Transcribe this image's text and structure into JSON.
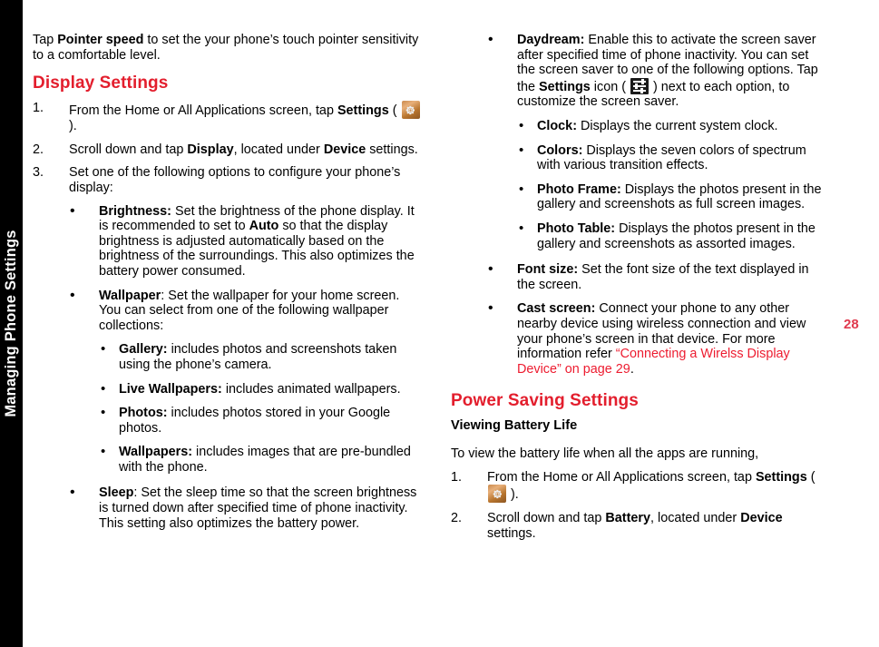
{
  "chapter_tab": {
    "label": "Managing Phone Settings"
  },
  "page_number": "28",
  "colors": {
    "heading_red": "#E31E2D",
    "xref_red": "#ED1C30",
    "page_number_red": "#E03A4E",
    "tab_background": "#000000"
  },
  "left_column": {
    "intro": {
      "before_bold": "Tap ",
      "bold": "Pointer speed",
      "after_bold": " to set the your phone’s touch pointer sensitivity to a comfortable level."
    },
    "section_heading": "Display Settings",
    "steps": [
      {
        "number": "1.",
        "text_a": "From the Home or All Applications screen, tap ",
        "bold_a": "Settings",
        "text_b": " ( ",
        "icon": "settings-gear-icon",
        "text_c": " )."
      },
      {
        "number": "2.",
        "text_a": "Scroll down and tap ",
        "bold_a": "Display",
        "text_b": ", located under ",
        "bold_b": "Device",
        "text_c": " settings."
      },
      {
        "number": "3.",
        "text_a": "Set one of the following options to configure your phone’s display:"
      }
    ],
    "bullets": [
      {
        "term": "Brightness:",
        "text_a": " Set the brightness of the phone display. It is recommended to set to ",
        "bold_inline": "Auto",
        "text_b": " so that the display brightness is adjusted automatically based on the brightness of the surroundings. This also optimizes the battery power consumed."
      },
      {
        "term": "Wallpaper",
        "text_a": ": Set the wallpaper for your home screen. You can select from one of the following wallpaper collections:",
        "sub_bullets": [
          {
            "term": "Gallery:",
            "text": " includes photos and screenshots taken using the phone’s camera."
          },
          {
            "term": "Live Wallpapers:",
            "text": " includes animated wallpapers."
          },
          {
            "term": "Photos:",
            "text": " includes photos stored in your Google photos."
          },
          {
            "term": "Wallpapers:",
            "text": " includes images that are pre-bundled with the phone."
          }
        ]
      },
      {
        "term": "Sleep",
        "text_a": ": Set the sleep time so that the screen brightness is turned down after specified time of phone inactivity. This setting also optimizes the battery power."
      }
    ]
  },
  "right_column": {
    "daydream_bullet": {
      "term": "Daydream:",
      "text_a": " Enable this to activate the screen saver after specified time of phone inactivity. You can set the screen saver to one of the following options. Tap the ",
      "bold_inline": "Settings",
      "text_b": " icon ( ",
      "icon": "sliders-settings-icon",
      "text_c": " ) next to each option, to customize the screen saver.",
      "sub_bullets": [
        {
          "term": "Clock:",
          "text": " Displays the current system clock."
        },
        {
          "term": "Colors:",
          "text": " Displays the seven colors of spectrum with various transition effects."
        },
        {
          "term": "Photo Frame:",
          "text": " Displays the photos present in the gallery and screenshots as full screen images."
        },
        {
          "term": "Photo Table:",
          "text": " Displays the photos present in the gallery and screenshots as assorted images."
        }
      ]
    },
    "font_size_bullet": {
      "term": "Font size:",
      "text": " Set the font size of the text displayed in the screen."
    },
    "cast_screen_bullet": {
      "term": "Cast screen:",
      "text_a": " Connect your phone to any other nearby device using wireless connection and view your phone’s screen in that device. For more information refer ",
      "xref": "“Connecting a Wirelss Display Device” on page 29",
      "text_b": "."
    },
    "section_heading": "Power Saving Settings",
    "sub_heading": "Viewing Battery Life",
    "intro": "To view the battery life when all the apps are running,",
    "steps": [
      {
        "number": "1.",
        "text_a": "From the Home or All Applications screen, tap ",
        "bold_a": "Settings",
        "text_b": " ( ",
        "icon": "settings-gear-icon",
        "text_c": " )."
      },
      {
        "number": "2.",
        "text_a": "Scroll down and tap ",
        "bold_a": "Battery",
        "text_b": ", located under ",
        "bold_b": "Device",
        "text_c": " settings."
      }
    ]
  }
}
